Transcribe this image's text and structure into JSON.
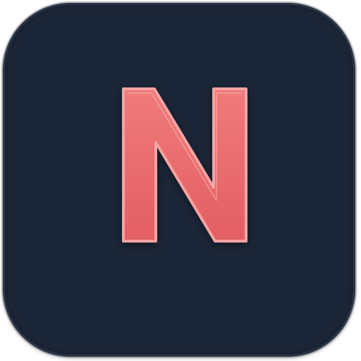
{
  "app_icon": {
    "letter": "N",
    "background_color": "#1b2638",
    "letter_color": "#ec6b6b"
  }
}
